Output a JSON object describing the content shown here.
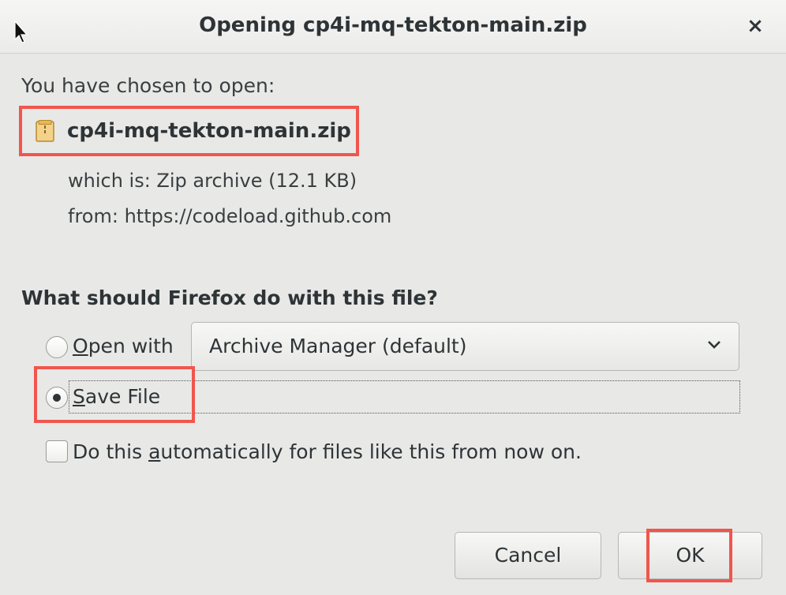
{
  "window": {
    "title": "Opening cp4i-mq-tekton-main.zip",
    "close_glyph": "×"
  },
  "dialog": {
    "intro": "You have chosen to open:",
    "filename": "cp4i-mq-tekton-main.zip",
    "type_line": "which is: Zip archive (12.1 KB)",
    "source_line": "from: https://codeload.github.com",
    "question": "What should Firefox do with this file?",
    "open_with": {
      "mnemonic": "O",
      "label_rest": "pen with",
      "selected": false,
      "app": "Archive Manager (default)"
    },
    "save_file": {
      "mnemonic": "S",
      "label_rest": "ave File",
      "selected": true
    },
    "auto": {
      "prefix": "Do this ",
      "mnemonic": "a",
      "rest": "utomatically for files like this from now on.",
      "checked": false
    },
    "buttons": {
      "cancel": "Cancel",
      "ok": "OK"
    }
  },
  "colors": {
    "highlight": "#f0564d",
    "background": "#e8e8e7",
    "text": "#2e3436"
  },
  "icons": [
    "cursor-icon",
    "close-icon",
    "archive-file-icon",
    "chevron-down-icon"
  ]
}
